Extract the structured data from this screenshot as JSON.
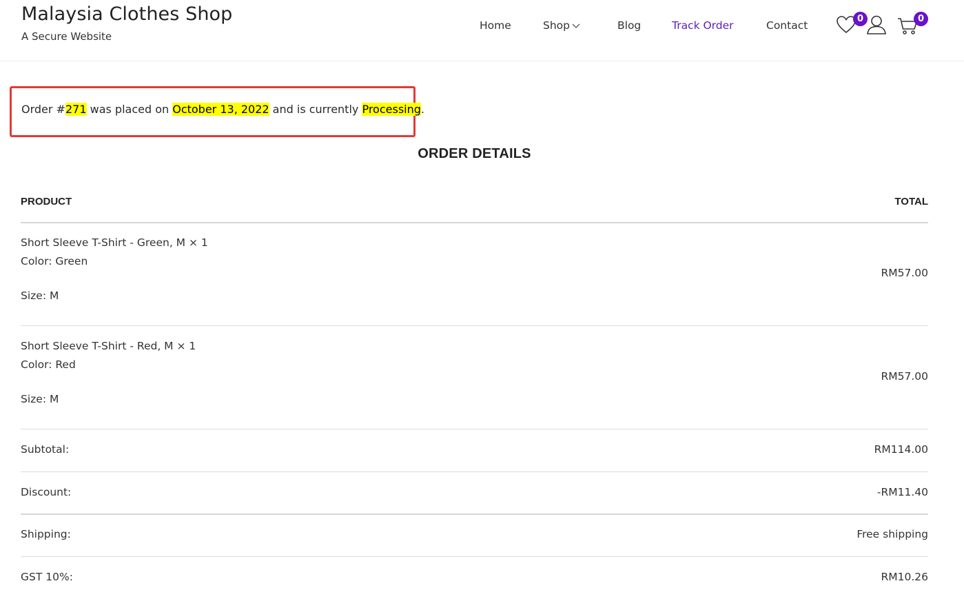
{
  "header": {
    "title": "Malaysia Clothes Shop",
    "tagline": "A Secure Website",
    "nav": [
      "Home",
      "Shop",
      "Blog",
      "Track Order",
      "Contact"
    ],
    "wishlist_count": "0",
    "cart_count": "0"
  },
  "notice": {
    "prefix": "Order #",
    "order_number": "271",
    "mid1": " was placed on ",
    "date": "October 13, 2022",
    "mid2": " and is currently ",
    "status": "Processing",
    "suffix": "."
  },
  "order_details": {
    "heading": "ORDER DETAILS",
    "col_product": "PRODUCT",
    "col_total": "TOTAL",
    "items": [
      {
        "name": "Short Sleeve T-Shirt - Green, M × 1",
        "color": "Color: Green",
        "size": "Size: M",
        "total": "RM57.00"
      },
      {
        "name": "Short Sleeve T-Shirt - Red, M × 1",
        "color": "Color: Red",
        "size": "Size: M",
        "total": "RM57.00"
      }
    ],
    "totals": [
      {
        "label": "Subtotal:",
        "value": "RM114.00"
      },
      {
        "label": "Discount:",
        "value": "-RM11.40"
      },
      {
        "label": "Shipping:",
        "value": "Free shipping"
      },
      {
        "label": "GST 10%:",
        "value": "RM10.26"
      }
    ]
  },
  "colors": {
    "accent": "#5b21b6",
    "badge": "#6a11cb",
    "highlight": "#ffff00",
    "notice_border": "#e53935"
  }
}
